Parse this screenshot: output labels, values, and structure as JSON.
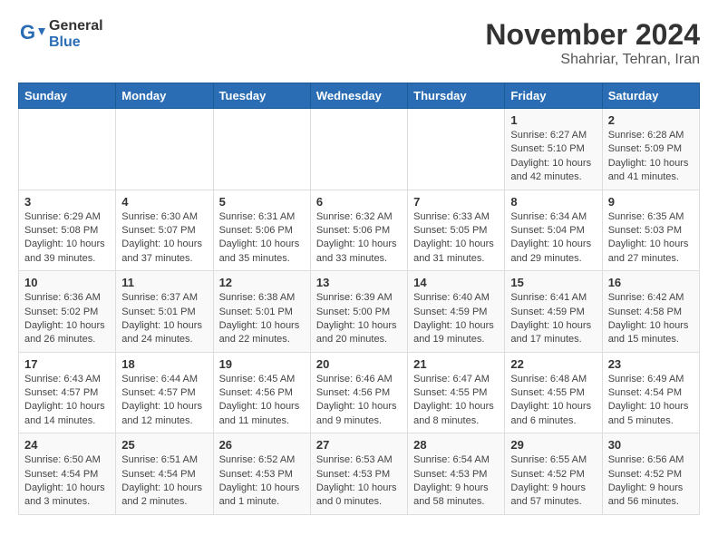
{
  "header": {
    "logo_general": "General",
    "logo_blue": "Blue",
    "month": "November 2024",
    "location": "Shahriar, Tehran, Iran"
  },
  "days_of_week": [
    "Sunday",
    "Monday",
    "Tuesday",
    "Wednesday",
    "Thursday",
    "Friday",
    "Saturday"
  ],
  "weeks": [
    [
      {
        "num": "",
        "info": ""
      },
      {
        "num": "",
        "info": ""
      },
      {
        "num": "",
        "info": ""
      },
      {
        "num": "",
        "info": ""
      },
      {
        "num": "",
        "info": ""
      },
      {
        "num": "1",
        "info": "Sunrise: 6:27 AM\nSunset: 5:10 PM\nDaylight: 10 hours and 42 minutes."
      },
      {
        "num": "2",
        "info": "Sunrise: 6:28 AM\nSunset: 5:09 PM\nDaylight: 10 hours and 41 minutes."
      }
    ],
    [
      {
        "num": "3",
        "info": "Sunrise: 6:29 AM\nSunset: 5:08 PM\nDaylight: 10 hours and 39 minutes."
      },
      {
        "num": "4",
        "info": "Sunrise: 6:30 AM\nSunset: 5:07 PM\nDaylight: 10 hours and 37 minutes."
      },
      {
        "num": "5",
        "info": "Sunrise: 6:31 AM\nSunset: 5:06 PM\nDaylight: 10 hours and 35 minutes."
      },
      {
        "num": "6",
        "info": "Sunrise: 6:32 AM\nSunset: 5:06 PM\nDaylight: 10 hours and 33 minutes."
      },
      {
        "num": "7",
        "info": "Sunrise: 6:33 AM\nSunset: 5:05 PM\nDaylight: 10 hours and 31 minutes."
      },
      {
        "num": "8",
        "info": "Sunrise: 6:34 AM\nSunset: 5:04 PM\nDaylight: 10 hours and 29 minutes."
      },
      {
        "num": "9",
        "info": "Sunrise: 6:35 AM\nSunset: 5:03 PM\nDaylight: 10 hours and 27 minutes."
      }
    ],
    [
      {
        "num": "10",
        "info": "Sunrise: 6:36 AM\nSunset: 5:02 PM\nDaylight: 10 hours and 26 minutes."
      },
      {
        "num": "11",
        "info": "Sunrise: 6:37 AM\nSunset: 5:01 PM\nDaylight: 10 hours and 24 minutes."
      },
      {
        "num": "12",
        "info": "Sunrise: 6:38 AM\nSunset: 5:01 PM\nDaylight: 10 hours and 22 minutes."
      },
      {
        "num": "13",
        "info": "Sunrise: 6:39 AM\nSunset: 5:00 PM\nDaylight: 10 hours and 20 minutes."
      },
      {
        "num": "14",
        "info": "Sunrise: 6:40 AM\nSunset: 4:59 PM\nDaylight: 10 hours and 19 minutes."
      },
      {
        "num": "15",
        "info": "Sunrise: 6:41 AM\nSunset: 4:59 PM\nDaylight: 10 hours and 17 minutes."
      },
      {
        "num": "16",
        "info": "Sunrise: 6:42 AM\nSunset: 4:58 PM\nDaylight: 10 hours and 15 minutes."
      }
    ],
    [
      {
        "num": "17",
        "info": "Sunrise: 6:43 AM\nSunset: 4:57 PM\nDaylight: 10 hours and 14 minutes."
      },
      {
        "num": "18",
        "info": "Sunrise: 6:44 AM\nSunset: 4:57 PM\nDaylight: 10 hours and 12 minutes."
      },
      {
        "num": "19",
        "info": "Sunrise: 6:45 AM\nSunset: 4:56 PM\nDaylight: 10 hours and 11 minutes."
      },
      {
        "num": "20",
        "info": "Sunrise: 6:46 AM\nSunset: 4:56 PM\nDaylight: 10 hours and 9 minutes."
      },
      {
        "num": "21",
        "info": "Sunrise: 6:47 AM\nSunset: 4:55 PM\nDaylight: 10 hours and 8 minutes."
      },
      {
        "num": "22",
        "info": "Sunrise: 6:48 AM\nSunset: 4:55 PM\nDaylight: 10 hours and 6 minutes."
      },
      {
        "num": "23",
        "info": "Sunrise: 6:49 AM\nSunset: 4:54 PM\nDaylight: 10 hours and 5 minutes."
      }
    ],
    [
      {
        "num": "24",
        "info": "Sunrise: 6:50 AM\nSunset: 4:54 PM\nDaylight: 10 hours and 3 minutes."
      },
      {
        "num": "25",
        "info": "Sunrise: 6:51 AM\nSunset: 4:54 PM\nDaylight: 10 hours and 2 minutes."
      },
      {
        "num": "26",
        "info": "Sunrise: 6:52 AM\nSunset: 4:53 PM\nDaylight: 10 hours and 1 minute."
      },
      {
        "num": "27",
        "info": "Sunrise: 6:53 AM\nSunset: 4:53 PM\nDaylight: 10 hours and 0 minutes."
      },
      {
        "num": "28",
        "info": "Sunrise: 6:54 AM\nSunset: 4:53 PM\nDaylight: 9 hours and 58 minutes."
      },
      {
        "num": "29",
        "info": "Sunrise: 6:55 AM\nSunset: 4:52 PM\nDaylight: 9 hours and 57 minutes."
      },
      {
        "num": "30",
        "info": "Sunrise: 6:56 AM\nSunset: 4:52 PM\nDaylight: 9 hours and 56 minutes."
      }
    ]
  ]
}
